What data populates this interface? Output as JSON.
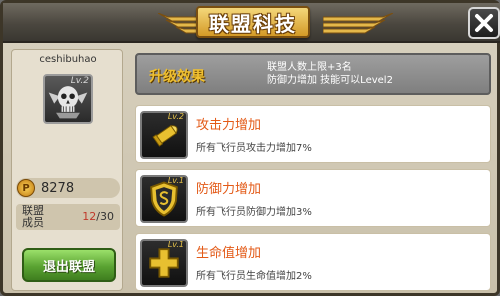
{
  "header": {
    "title": "联盟科技",
    "close_icon": "close-icon"
  },
  "player": {
    "name": "ceshibuhao",
    "avatar_icon": "skull-wings-emblem-icon",
    "avatar_level": "Lv.2",
    "currency_symbol": "P",
    "currency_icon": "coin-icon",
    "currency_value": "8278",
    "members_label": "联盟成员",
    "members_current": "12",
    "members_separator": "/",
    "members_max": "30",
    "leave_label": "退出联盟"
  },
  "upgrade": {
    "label": "升级效果",
    "line1": "联盟人数上限+3名",
    "line2": "防御力增加 技能可以Level2"
  },
  "techs": [
    {
      "icon": "bullet-icon",
      "level": "Lv.2",
      "name": "攻击力增加",
      "desc": "所有飞行员攻击力增加7%"
    },
    {
      "icon": "shield-icon",
      "level": "Lv.1",
      "name": "防御力增加",
      "desc": "所有飞行员防御力增加3%"
    },
    {
      "icon": "health-cross-icon",
      "level": "Lv.1",
      "name": "生命值增加",
      "desc": "所有飞行员生命值增加2%"
    }
  ],
  "colors": {
    "accent": "#e35a17",
    "gold": "#f0c030",
    "button_green": "#5aa332"
  }
}
